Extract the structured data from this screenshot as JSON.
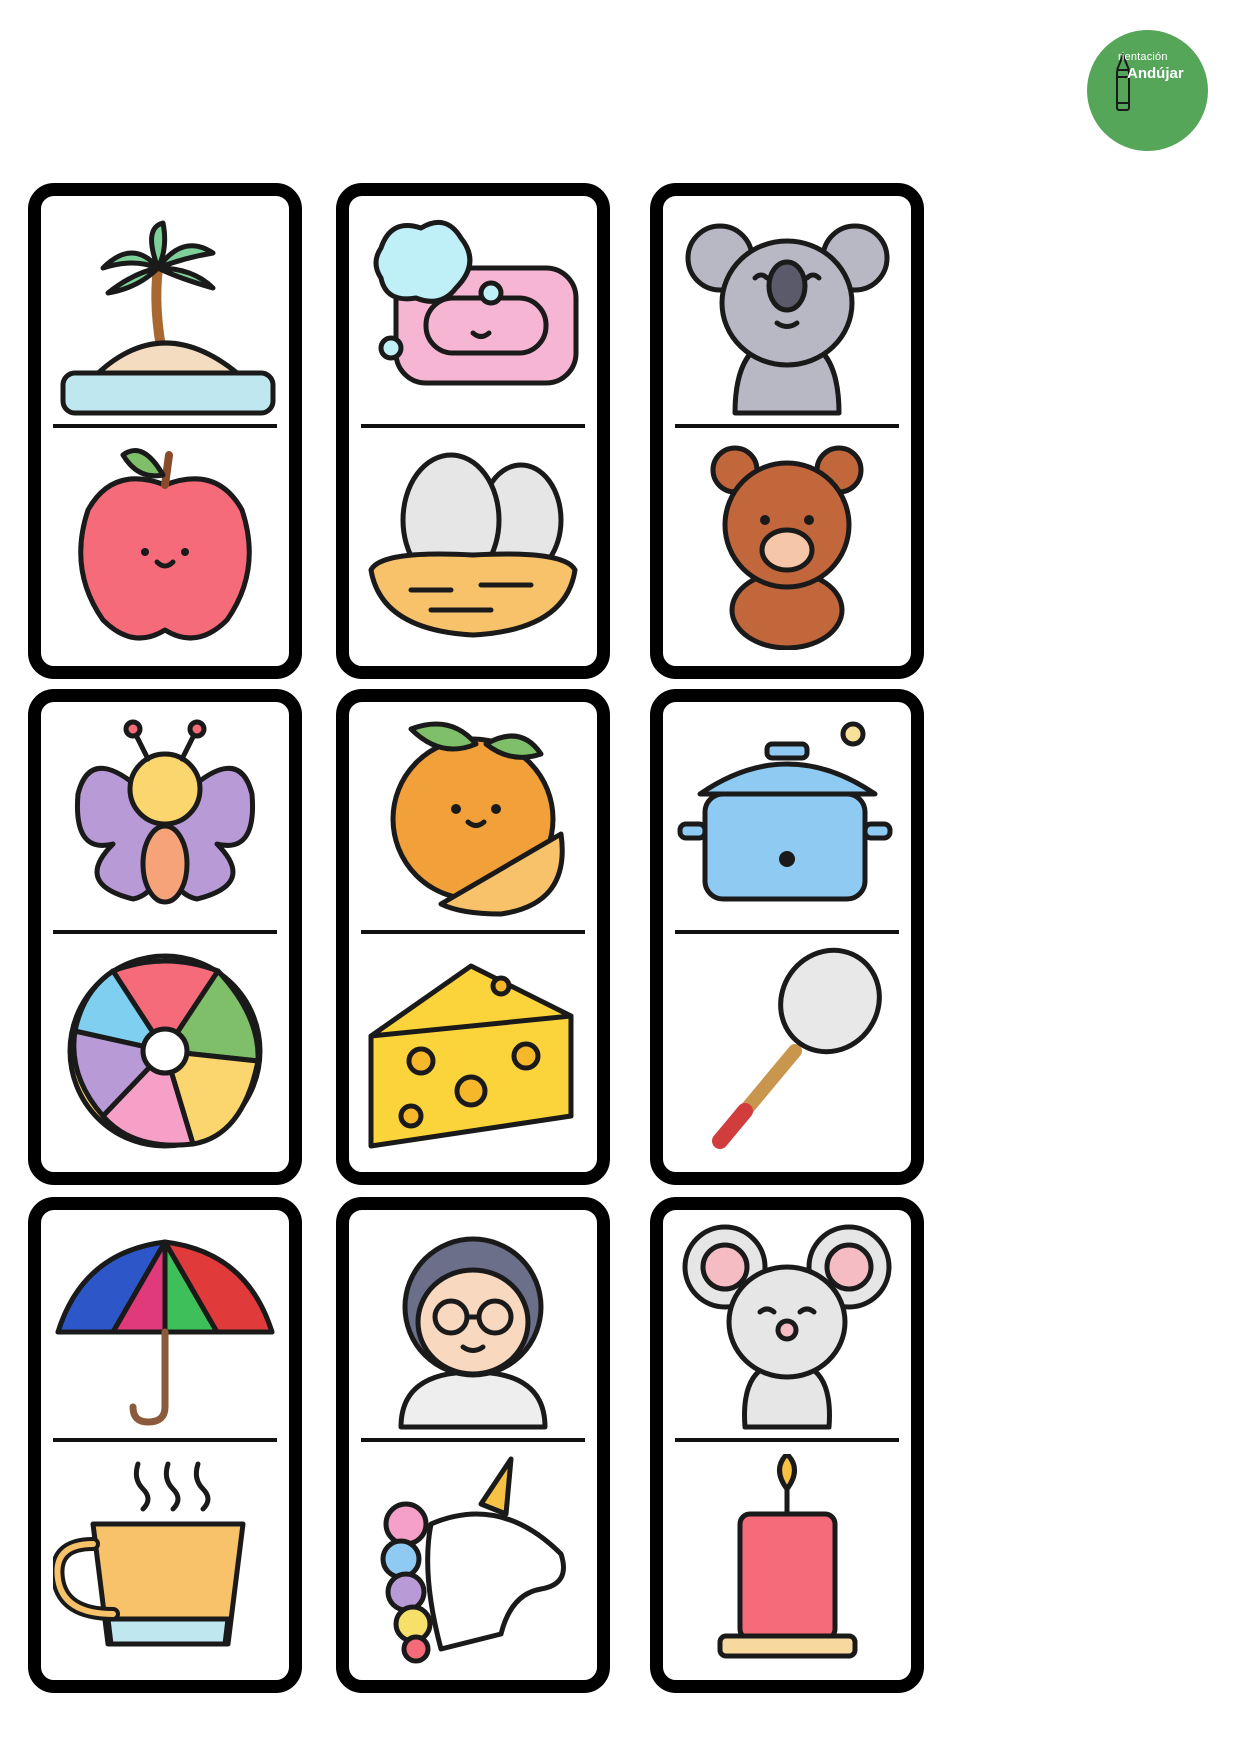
{
  "logo": {
    "small_text": "rientación",
    "big_text": "Andújar",
    "color": "#56a65a",
    "icon": "pencil-icon"
  },
  "dominoes": [
    {
      "top": "island-icon",
      "bottom": "apple-icon"
    },
    {
      "top": "soap-icon",
      "bottom": "eggs-nest-icon"
    },
    {
      "top": "koala-icon",
      "bottom": "teddy-bear-icon"
    },
    {
      "top": "butterfly-icon",
      "bottom": "beach-ball-icon"
    },
    {
      "top": "orange-icon",
      "bottom": "cheese-icon"
    },
    {
      "top": "cooking-pot-icon",
      "bottom": "tennis-racket-icon"
    },
    {
      "top": "umbrella-icon",
      "bottom": "tea-cup-icon"
    },
    {
      "top": "scientist-icon",
      "bottom": "unicorn-icon"
    },
    {
      "top": "mouse-icon",
      "bottom": "candle-icon"
    }
  ]
}
